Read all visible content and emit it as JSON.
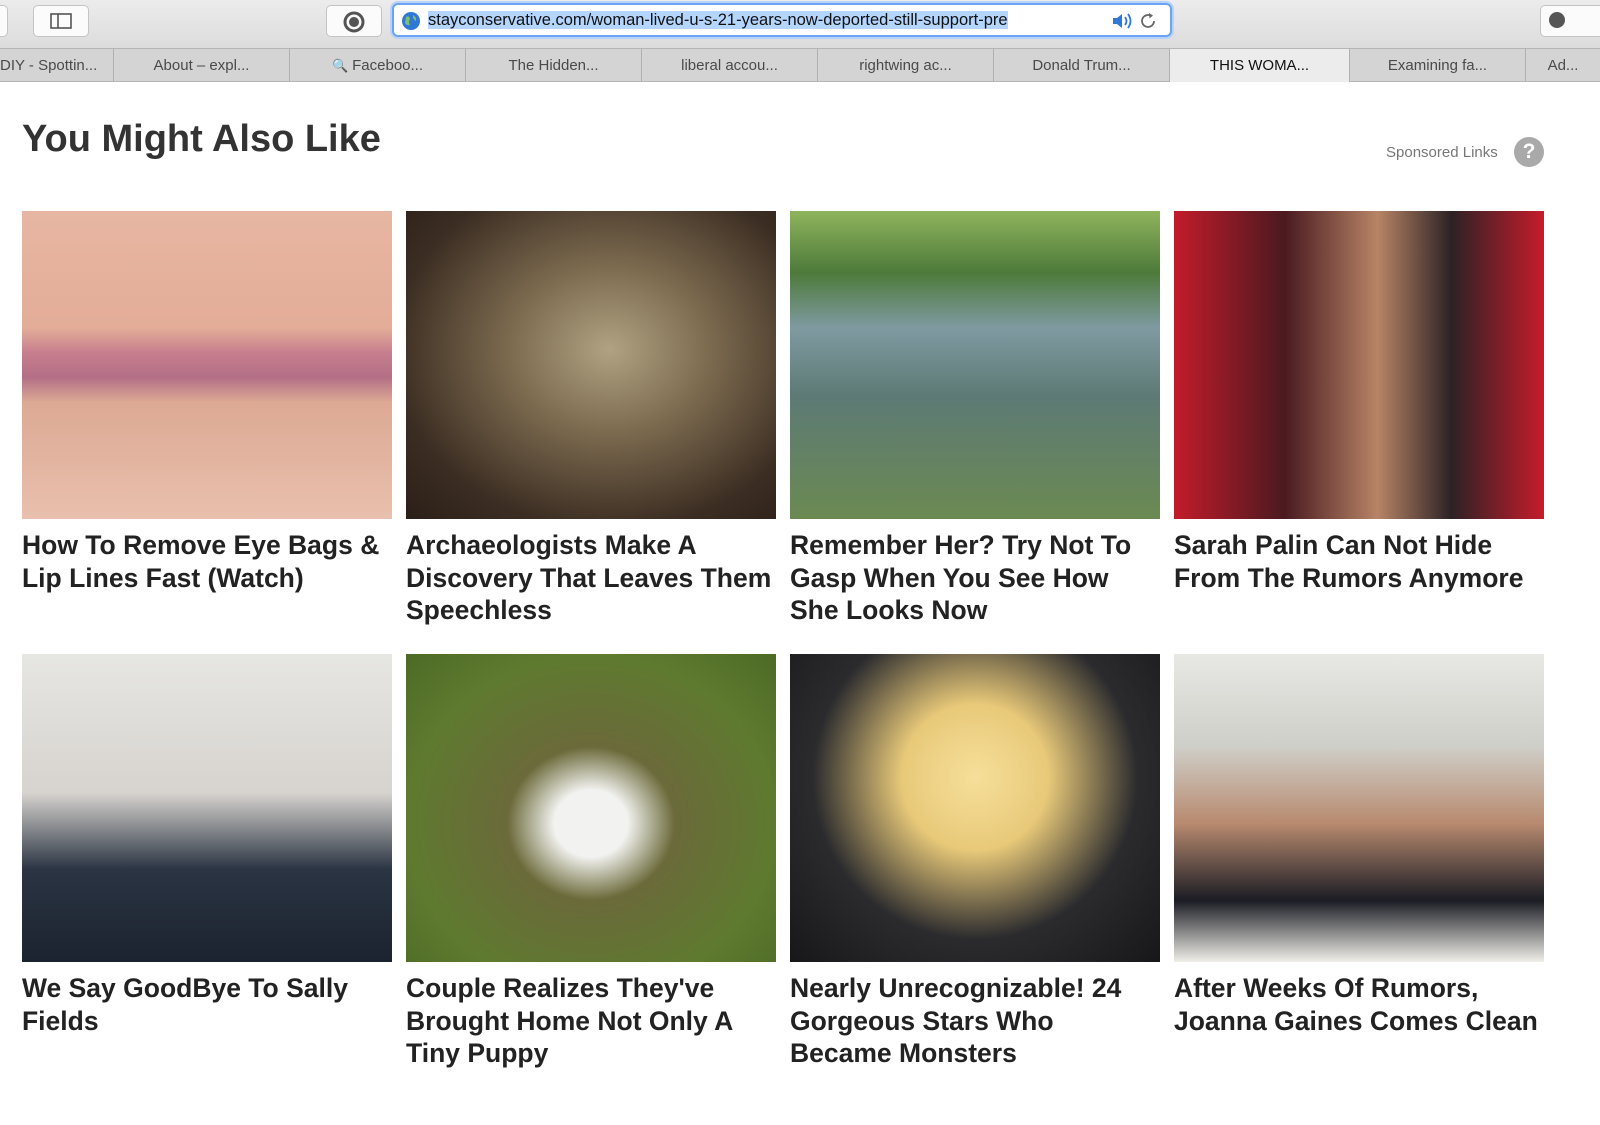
{
  "browser": {
    "url": "stayconservative.com/woman-lived-u-s-21-years-now-deported-still-support-pre",
    "tabs": [
      {
        "label": "DIY - Spottin...",
        "active": false
      },
      {
        "label": "About – expl...",
        "active": false
      },
      {
        "label": "Faceboo...",
        "active": false
      },
      {
        "label": "The Hidden...",
        "active": false
      },
      {
        "label": "liberal accou...",
        "active": false
      },
      {
        "label": "rightwing ac...",
        "active": false
      },
      {
        "label": "Donald Trum...",
        "active": false
      },
      {
        "label": "THIS WOMA...",
        "active": true
      },
      {
        "label": "Examining fa...",
        "active": false
      },
      {
        "label": "Ad...",
        "active": false
      }
    ]
  },
  "page": {
    "heading": "You Might Also Like",
    "sponsored_label": "Sponsored Links",
    "help_glyph": "?"
  },
  "cards": [
    {
      "caption": "How To Remove Eye Bags & Lip Lines Fast (Watch)",
      "image": "closeup-lips-image"
    },
    {
      "caption": "Archaeologists Make A Discovery That Leaves Them Speechless",
      "image": "skull-image"
    },
    {
      "caption": "Remember Her? Try Not To Gasp When You See How She Looks Now",
      "image": "woman-by-lake-image"
    },
    {
      "caption": "Sarah Palin Can Not Hide From The Rumors Anymore",
      "image": "sarah-palin-image"
    },
    {
      "caption": "We Say GoodBye To Sally Fields",
      "image": "sally-field-image"
    },
    {
      "caption": "Couple Realizes They've Brought Home Not Only A Tiny Puppy",
      "image": "dalmatian-puppy-image"
    },
    {
      "caption": "Nearly Unrecognizable! 24 Gorgeous Stars Who Became Monsters",
      "image": "blonde-star-image"
    },
    {
      "caption": "After Weeks Of Rumors, Joanna Gaines Comes Clean",
      "image": "joanna-gaines-image"
    }
  ]
}
